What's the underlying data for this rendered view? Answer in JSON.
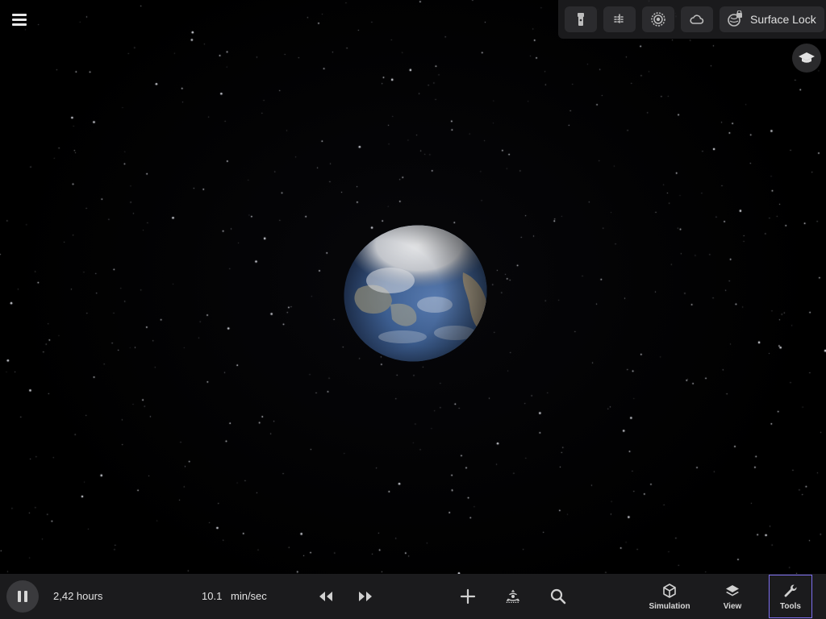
{
  "app": {
    "menu_icon": "hamburger-menu-icon"
  },
  "top_toolbar": {
    "buttons": [
      {
        "icon": "flashlight-icon"
      },
      {
        "icon": "grid-lines-icon"
      },
      {
        "icon": "orbit-ring-icon"
      },
      {
        "icon": "cloud-icon"
      }
    ],
    "surface_lock": {
      "label": "Surface Lock",
      "icon": "surface-lock-icon"
    }
  },
  "education_button": {
    "icon": "graduation-cap-icon"
  },
  "viewport": {
    "body": "earth-globe"
  },
  "bottom_bar": {
    "elapsed_time": "2,42 hours",
    "rate_value": "10.1",
    "rate_unit": "min/sec",
    "nav": [
      {
        "label": "Simulation",
        "icon": "cube-icon",
        "active": false
      },
      {
        "label": "View",
        "icon": "layers-icon",
        "active": false
      },
      {
        "label": "Tools",
        "icon": "wrench-icon",
        "active": true
      }
    ]
  },
  "colors": {
    "bottom_bar_bg": "#1b1b1d",
    "active_outline": "#7d6ff0",
    "toolbar_bg": "#1c1c1e"
  }
}
